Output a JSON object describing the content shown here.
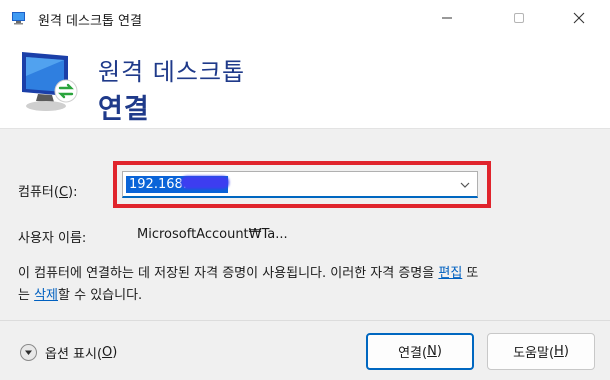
{
  "window": {
    "title": "원격 데스크톱 연결",
    "controls": {
      "minimize_icon": "minimize-icon",
      "maximize_icon": "maximize-icon",
      "close_icon": "close-icon"
    }
  },
  "banner": {
    "line1": "원격 데스크톱",
    "line2": "연결",
    "icon": "remote-desktop-monitor-icon"
  },
  "form": {
    "computer_label_pre": "컴퓨터(",
    "computer_label_key": "C",
    "computer_label_post": "):",
    "computer_value": "192.168.",
    "user_label": "사용자 이름:",
    "user_value": "MicrosoftAccount₩Ta..."
  },
  "info": {
    "part1": "이 컴퓨터에 연결하는 데 저장된 자격 증명이 사용됩니다. 이러한 자격 증명을 ",
    "edit_link": "편집",
    "part2": " 또는 ",
    "delete_link": "삭제",
    "part3": "할 수 있습니다."
  },
  "footer": {
    "options_pre": "옵션 표시(",
    "options_key": "O",
    "options_post": ")",
    "connect_pre": "연결(",
    "connect_key": "N",
    "connect_post": ")",
    "help_pre": "도움말(",
    "help_key": "H",
    "help_post": ")"
  },
  "colors": {
    "accent": "#0067c0",
    "highlight_border": "#e0242c",
    "header_text": "#1f3a8a",
    "link": "#0060c0"
  }
}
